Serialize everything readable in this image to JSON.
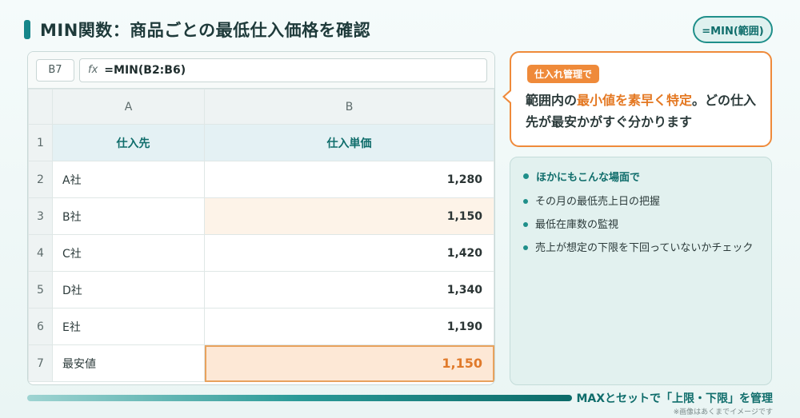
{
  "title": "MIN関数：商品ごとの最低仕入価格を確認",
  "pill": "=MIN(範囲)",
  "spreadsheet": {
    "cell_ref": "B7",
    "fx": "fx",
    "formula": "=MIN(B2:B6)",
    "columns": [
      "A",
      "B"
    ],
    "row_numbers": [
      "1",
      "2",
      "3",
      "4",
      "5",
      "6",
      "7"
    ],
    "header": {
      "a": "仕入先",
      "b": "仕入単価"
    },
    "rows": [
      {
        "a": "A社",
        "b": "1,280"
      },
      {
        "a": "B社",
        "b": "1,150"
      },
      {
        "a": "C社",
        "b": "1,420"
      },
      {
        "a": "D社",
        "b": "1,340"
      },
      {
        "a": "E社",
        "b": "1,190"
      }
    ],
    "result": {
      "a": "最安値",
      "b": "1,150"
    }
  },
  "callout": {
    "tag": "仕入れ管理で",
    "text_before": "範囲内の",
    "text_highlight": "最小値を素早く特定",
    "text_after": "。どの仕入先が最安かがすぐ分かります"
  },
  "panel": {
    "heading": "ほかにもこんな場面で",
    "items": [
      "その月の最低売上日の把握",
      "最低在庫数の監視",
      "売上が想定の下限を下回っていないかチェック"
    ]
  },
  "footer": "MAXとセットで「上限・下限」を管理",
  "note": "※画像はあくまでイメージです",
  "colors": {
    "accent": "#15868a",
    "highlight": "#ef8a3a"
  }
}
